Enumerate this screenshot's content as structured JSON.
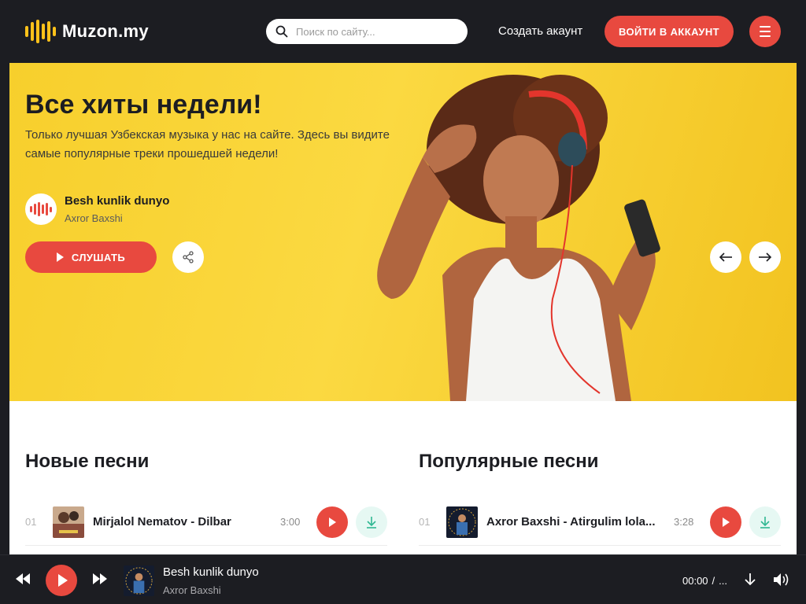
{
  "header": {
    "logo_text": "Muzon.my",
    "search_placeholder": "Поиск по сайту...",
    "create_account": "Создать акаунт",
    "login_button": "ВОЙТИ В АККАУНТ",
    "accent": "#e8493f",
    "logo_color": "#ffc21a"
  },
  "hero": {
    "title": "Все хиты недели!",
    "description": "Только лучшая Узбекская музыка у нас на сайте. Здесь вы видите самые популярные треки прошедшей недели!",
    "track_title": "Besh kunlik dunyo",
    "track_artist": "Axror Baxshi",
    "listen_button": "СЛУШАТЬ",
    "background": "#fbd941"
  },
  "new_songs": {
    "title": "Новые песни",
    "items": [
      {
        "num": "01",
        "name": "Mirjalol Nematov - Dilbar",
        "duration": "3:00"
      }
    ]
  },
  "popular_songs": {
    "title": "Популярные песни",
    "items": [
      {
        "num": "01",
        "name": "Axror Baxshi - Atirgulim lola...",
        "duration": "3:28"
      }
    ]
  },
  "player": {
    "title": "Besh kunlik dunyo",
    "artist": "Axror Baxshi",
    "current_time": "00:00",
    "separator": "/",
    "total": "..."
  }
}
